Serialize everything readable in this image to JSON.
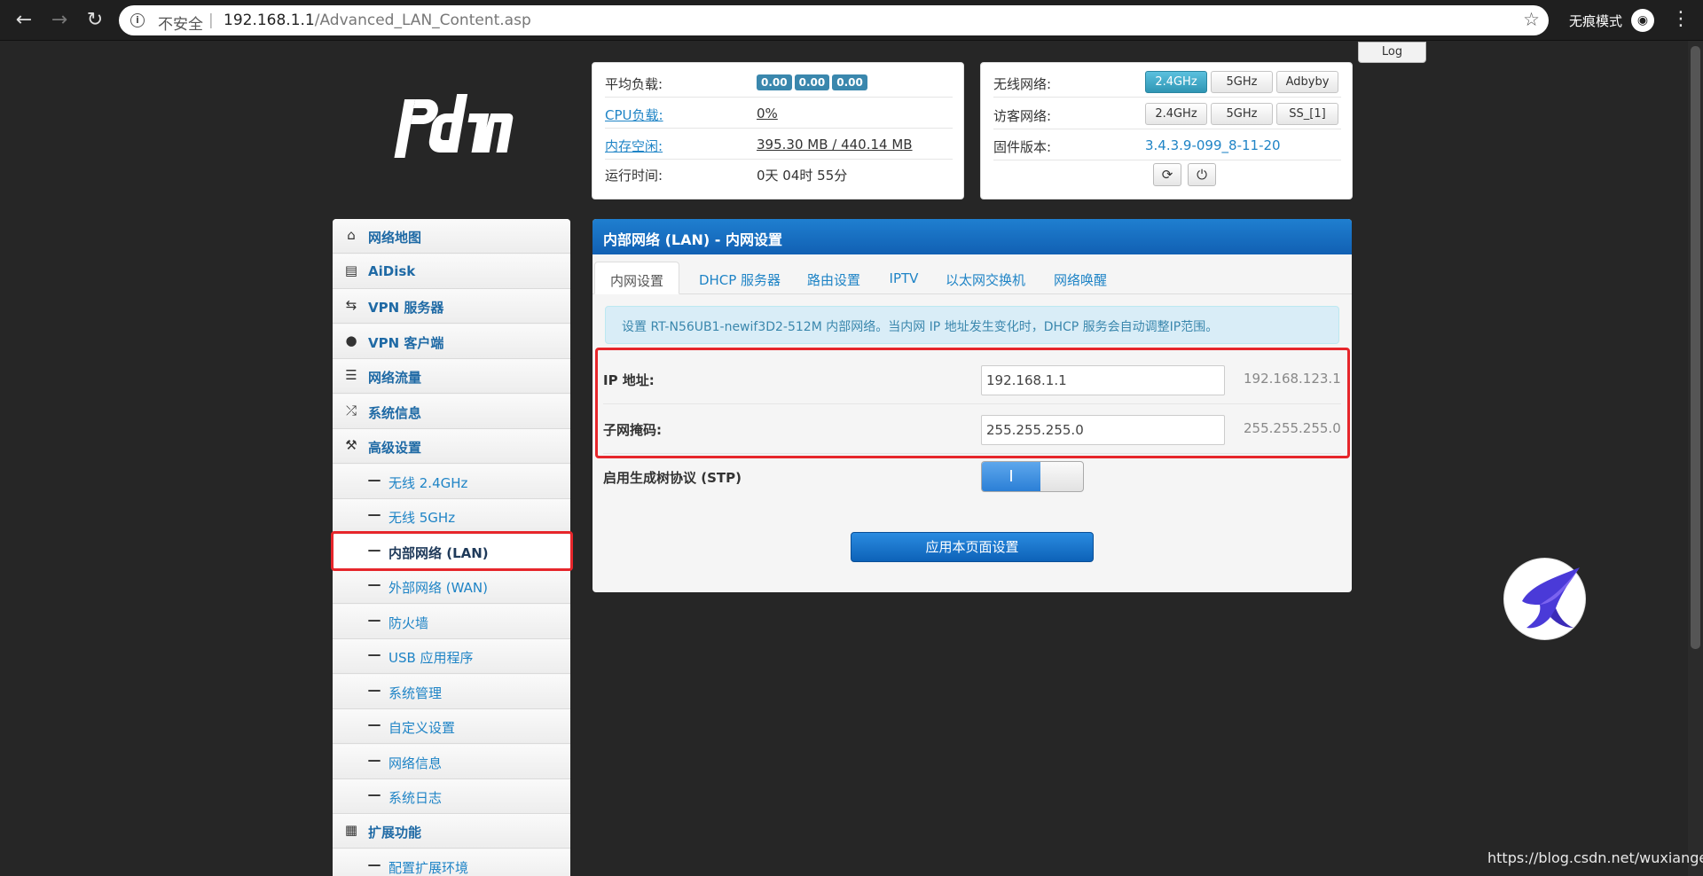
{
  "browser": {
    "insecure": "不安全",
    "separator": "|",
    "url_host": "192.168.1.1",
    "url_path": "/Advanced_LAN_Content.asp",
    "incognito": "无痕模式"
  },
  "log_label": "Log",
  "status_left": {
    "rows": [
      {
        "label": "平均负载:",
        "badges": [
          "0.00",
          "0.00",
          "0.00"
        ]
      },
      {
        "label": "CPU负载:",
        "value": "0%"
      },
      {
        "label": "内存空闲:",
        "value": "395.30 MB / 440.14 MB"
      },
      {
        "label": "运行时间:",
        "value": "0天 04时 55分"
      }
    ]
  },
  "status_right": {
    "wireless_label": "无线网络:",
    "wireless_buttons": [
      "2.4GHz",
      "5GHz",
      "Adbyby"
    ],
    "guest_label": "访客网络:",
    "guest_buttons": [
      "2.4GHz",
      "5GHz",
      "SS_[1]"
    ],
    "firmware_label": "固件版本:",
    "firmware_value": "3.4.3.9-099_8-11-20"
  },
  "sidebar": {
    "items": [
      {
        "label": "网络地图",
        "icon": "home-icon"
      },
      {
        "label": "AiDisk",
        "icon": "hdd-icon"
      },
      {
        "label": "VPN 服务器",
        "icon": "retweet-icon"
      },
      {
        "label": "VPN 客户端",
        "icon": "globe-icon"
      },
      {
        "label": "网络流量",
        "icon": "tasks-icon"
      },
      {
        "label": "系统信息",
        "icon": "random-icon"
      },
      {
        "label": "高级设置",
        "icon": "wrench-icon"
      },
      {
        "label": "无线 2.4GHz",
        "icon": "minus-icon"
      },
      {
        "label": "无线 5GHz",
        "icon": "minus-icon"
      },
      {
        "label": "内部网络 (LAN)",
        "icon": "minus-icon"
      },
      {
        "label": "外部网络 (WAN)",
        "icon": "minus-icon"
      },
      {
        "label": "防火墙",
        "icon": "minus-icon"
      },
      {
        "label": "USB 应用程序",
        "icon": "minus-icon"
      },
      {
        "label": "系统管理",
        "icon": "minus-icon"
      },
      {
        "label": "自定义设置",
        "icon": "minus-icon"
      },
      {
        "label": "网络信息",
        "icon": "minus-icon"
      },
      {
        "label": "系统日志",
        "icon": "minus-icon"
      },
      {
        "label": "扩展功能",
        "icon": "th-icon"
      },
      {
        "label": "配置扩展环境",
        "icon": "minus-icon"
      }
    ]
  },
  "main": {
    "title": "内部网络 (LAN) - 内网设置",
    "tabs": [
      "内网设置",
      "DHCP 服务器",
      "路由设置",
      "IPTV",
      "以太网交换机",
      "网络唤醒"
    ],
    "alert": "设置 RT-N56UB1-newif3D2-512M 内部网络。当内网 IP 地址发生变化时，DHCP 服务会自动调整IP范围。",
    "ip_label": "IP 地址:",
    "ip_value": "192.168.1.1",
    "ip_hint": "192.168.123.1",
    "mask_label": "子网掩码:",
    "mask_value": "255.255.255.0",
    "mask_hint": "255.255.255.0",
    "stp_label": "启用生成树协议 (STP)",
    "stp_on_glyph": "I",
    "apply_label": "应用本页面设置"
  },
  "watermark": "https://blog.csdn.net/wuxiangeg"
}
